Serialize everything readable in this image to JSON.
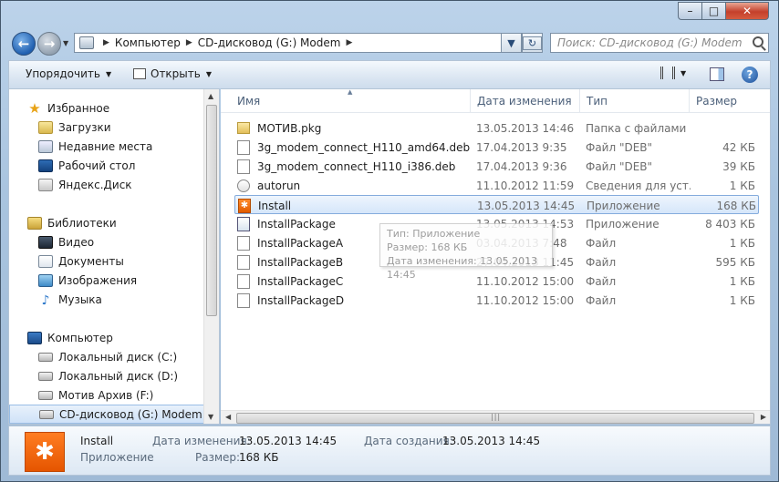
{
  "window": {
    "min_label": "–",
    "max_label": "□",
    "close_label": "✕"
  },
  "address": {
    "crumbs": [
      "Компьютер",
      "CD-дисковод (G:) Modem"
    ],
    "search_placeholder": "Поиск: CD-дисковод (G:) Modem"
  },
  "toolbar": {
    "organize": "Упорядочить",
    "open": "Открыть"
  },
  "nav": {
    "favorites": "Избранное",
    "fav_items": [
      "Загрузки",
      "Недавние места",
      "Рабочий стол",
      "Яндекс.Диск"
    ],
    "libraries": "Библиотеки",
    "lib_items": [
      "Видео",
      "Документы",
      "Изображения",
      "Музыка"
    ],
    "computer": "Компьютер",
    "drives": [
      "Локальный диск (C:)",
      "Локальный диск (D:)",
      "Мотив Архив (F:)",
      "CD-дисковод (G:) Modem"
    ]
  },
  "columns": {
    "name": "Имя",
    "date": "Дата изменения",
    "type": "Тип",
    "size": "Размер"
  },
  "files": [
    {
      "name": "МОТИВ.pkg",
      "date": "13.05.2013 14:46",
      "type": "Папка с файлами",
      "size": "",
      "icon": "folder-icon"
    },
    {
      "name": "3g_modem_connect_H110_amd64.deb",
      "date": "17.04.2013 9:35",
      "type": "Файл \"DEB\"",
      "size": "42 КБ",
      "icon": "file-icon"
    },
    {
      "name": "3g_modem_connect_H110_i386.deb",
      "date": "17.04.2013 9:36",
      "type": "Файл \"DEB\"",
      "size": "39 КБ",
      "icon": "file-icon"
    },
    {
      "name": "autorun",
      "date": "11.10.2012 11:59",
      "type": "Сведения для уст...",
      "size": "1 КБ",
      "icon": "autorun-icon"
    },
    {
      "name": "Install",
      "date": "13.05.2013 14:45",
      "type": "Приложение",
      "size": "168 КБ",
      "icon": "app-icon"
    },
    {
      "name": "InstallPackage",
      "date": "13.05.2013 14:53",
      "type": "Приложение",
      "size": "8 403 КБ",
      "icon": "setup-icon"
    },
    {
      "name": "InstallPackageA",
      "date": "03.04.2013 7:48",
      "type": "Файл",
      "size": "1 КБ",
      "icon": "file-icon"
    },
    {
      "name": "InstallPackageB",
      "date": "27.04.2013 11:45",
      "type": "Файл",
      "size": "595 КБ",
      "icon": "file-icon"
    },
    {
      "name": "InstallPackageC",
      "date": "11.10.2012 15:00",
      "type": "Файл",
      "size": "1 КБ",
      "icon": "file-icon"
    },
    {
      "name": "InstallPackageD",
      "date": "11.10.2012 15:00",
      "type": "Файл",
      "size": "1 КБ",
      "icon": "file-icon"
    }
  ],
  "tooltip": {
    "line1": "Тип: Приложение",
    "line2": "Размер: 168 КБ",
    "line3": "Дата изменения: 13.05.2013 14:45"
  },
  "details": {
    "name": "Install",
    "kind": "Приложение",
    "modified_label": "Дата изменения:",
    "modified_value": "13.05.2013 14:45",
    "size_label": "Размер:",
    "size_value": "168 КБ",
    "created_label": "Дата создания:",
    "created_value": "13.05.2013 14:45"
  },
  "colors": {
    "accent": "#1f5fb0",
    "app_icon": "#f26a0f",
    "selection": "#d5e6fa"
  }
}
